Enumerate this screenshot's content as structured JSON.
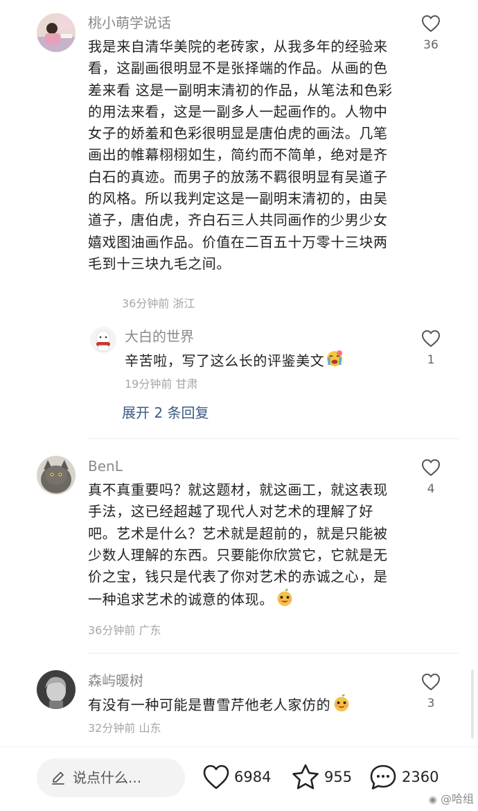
{
  "comments": [
    {
      "username": "桃小萌学说话",
      "text": "我是来自清华美院的老砖家，从我多年的经验来看，这副画很明显不是张择端的作品。从画的色差来看 这是一副明末清初的作品，从笔法和色彩的用法来看，这是一副多人一起画作的。人物中女子的娇羞和色彩很明显是唐伯虎的画法。几笔画出的帷幕栩栩如生，简约而不简单，绝对是齐白石的真迹。而男子的放荡不羁很明显有吴道子的风格。所以我判定这是一副明末清初的，由吴道子，唐伯虎，齐白石三人共同画作的少男少女嬉戏图油画作品。价值在二百五十万零十三块两毛到十三块九毛之间。",
      "time": "36分钟前",
      "location": "浙江",
      "likes": "36",
      "reply": {
        "username": "大白的世界",
        "text": "辛苦啦，写了这么长的评鉴美文",
        "emoji": "crying-emoji",
        "time": "19分钟前",
        "location": "甘肃",
        "likes": "1"
      },
      "expand_label": "展开 2 条回复"
    },
    {
      "username": "BenL",
      "text": "真不真重要吗？就这题材，就这画工，就这表现手法，这已经超越了现代人对艺术的理解了好吧。艺术是什么？艺术就是超前的，就是只能被少数人理解的东西。只要能你欣赏它，它就是无价之宝，钱只是代表了你对艺术的赤诚之心，是一种追求艺术的诚意的体现。",
      "emoji": "smirk-face-emoji",
      "time": "36分钟前",
      "location": "广东",
      "likes": "4"
    },
    {
      "username": "森屿暖树",
      "text": "有没有一种可能是曹雪芹他老人家仿的",
      "emoji": "smirk-face-emoji",
      "time": "32分钟前",
      "location": "山东",
      "likes": "3"
    }
  ],
  "bottom_bar": {
    "input_placeholder": "说点什么...",
    "likes": "6984",
    "favorites": "955",
    "comments": "2360"
  },
  "watermark": "@哈组",
  "colors": {
    "name_gray": "#8a8a8a",
    "link_blue": "#3b5a86",
    "text": "#222222"
  }
}
